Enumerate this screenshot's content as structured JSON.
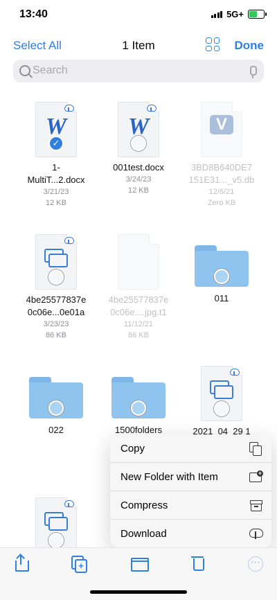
{
  "status_bar": {
    "time": "13:40",
    "network": "5G+"
  },
  "nav": {
    "select_all": "Select All",
    "title": "1 Item",
    "done": "Done"
  },
  "search": {
    "placeholder": "Search"
  },
  "files": [
    {
      "name_line1": "1-",
      "name_line2": "MultiT...2.docx",
      "date": "3/21/23",
      "size": "12 KB",
      "icon": "word-doc-icon",
      "selected": true
    },
    {
      "name_line1": "001test.docx",
      "name_line2": "",
      "date": "3/24/23",
      "size": "12 KB",
      "icon": "word-doc-icon",
      "selected": false
    },
    {
      "name_line1": "3BD8B640DE7",
      "name_line2": "151E31..._v5.db",
      "date": "12/6/21",
      "size": "Zero KB",
      "icon": "db-file-icon",
      "dimmed": true
    },
    {
      "name_line1": "4be25577837e",
      "name_line2": "0c06e...0e01a",
      "date": "3/23/23",
      "size": "86 KB",
      "icon": "stack-doc-icon",
      "selected": false
    },
    {
      "name_line1": "4be25577837e",
      "name_line2": "0c06e....jpg.t1",
      "date": "11/12/21",
      "size": "86 KB",
      "icon": "blank-doc-icon",
      "dimmed": true
    },
    {
      "name_line1": "011",
      "name_line2": "",
      "icon": "folder-icon"
    },
    {
      "name_line1": "022",
      "name_line2": "",
      "icon": "folder-icon"
    },
    {
      "name_line1": "1500folders",
      "name_line2": "",
      "icon": "folder-icon"
    },
    {
      "name_line1": "2021_04_29 1",
      "name_line2": "",
      "icon": "stack-doc-icon"
    },
    {
      "name_line1": "",
      "name_line2": "",
      "icon": "stack-doc-icon"
    }
  ],
  "context_menu": {
    "items": [
      {
        "label": "Copy",
        "icon": "copy-icon"
      },
      {
        "label": "New Folder with Item",
        "icon": "new-folder-icon"
      },
      {
        "label": "Compress",
        "icon": "archive-icon"
      },
      {
        "label": "Download",
        "icon": "cloud-download-icon"
      }
    ]
  },
  "toolbar": {
    "more": "···"
  },
  "colors": {
    "accent": "#2f7fe0",
    "folder": "#8fc4ee",
    "battery": "#34c759"
  }
}
